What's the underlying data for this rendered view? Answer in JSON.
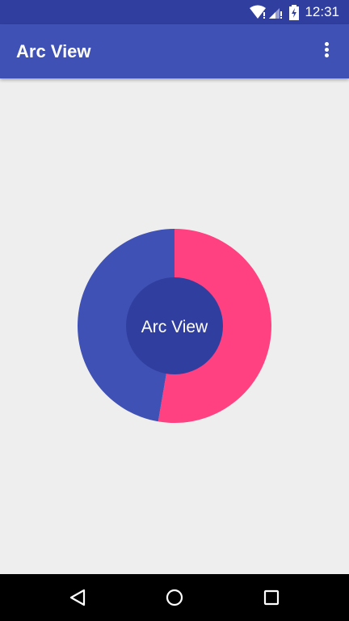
{
  "status_bar": {
    "time": "12:31",
    "icons": [
      "wifi-icon",
      "signal-icon",
      "battery-charging-icon"
    ]
  },
  "app_bar": {
    "title": "Arc View",
    "menu_icon": "more-vert-icon"
  },
  "arc_view": {
    "center_label": "Arc View",
    "segments": [
      {
        "name": "pink",
        "percent": 52.7,
        "color": "#ff4081"
      },
      {
        "name": "blue",
        "percent": 47.3,
        "color": "#3f51b5"
      }
    ],
    "center_color": "#303f9f"
  },
  "nav_bar": {
    "icons": [
      "back-icon",
      "home-icon",
      "recents-icon"
    ]
  }
}
